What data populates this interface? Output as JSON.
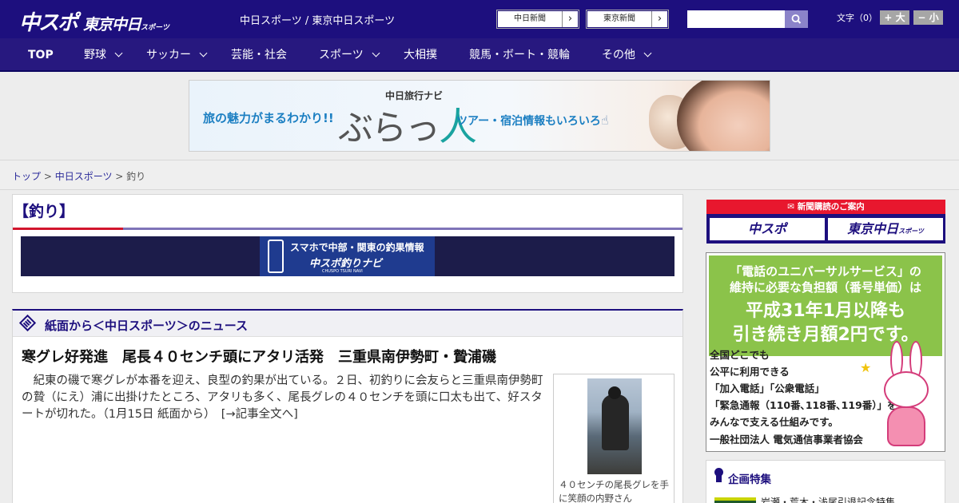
{
  "header": {
    "logo_chuspo": "中スポ",
    "logo_tokyo": "東京中日",
    "logo_tokyo_small": "スポーツ",
    "site_name": "中日スポーツ / 東京中日スポーツ",
    "paper_buttons": [
      {
        "label": "中日新聞",
        "arrow": "›"
      },
      {
        "label": "東京新聞",
        "arrow": "›"
      }
    ],
    "search_placeholder": "",
    "font_size_label": "文字（0）",
    "font_bigger": "+ 大",
    "font_smaller": "− 小"
  },
  "nav": {
    "items": [
      {
        "label": "TOP"
      },
      {
        "label": "野球"
      },
      {
        "label": "サッカー"
      },
      {
        "label": "芸能・社会"
      },
      {
        "label": "スポーツ"
      },
      {
        "label": "大相撲"
      },
      {
        "label": "競馬・ボート・競輪"
      },
      {
        "label": "その他"
      }
    ]
  },
  "ad": {
    "text_left": "旅の魅力がまるわかり!!",
    "brand_sub": "中日旅行ナビ",
    "brand_main": "ぶらっ",
    "brand_hito": "人",
    "text_right": "ツアー・宿泊情報もいろいろ",
    "hand": "☝"
  },
  "breadcrumb": {
    "items": [
      "トップ",
      "中日スポーツ",
      "釣り"
    ],
    "separator": " > "
  },
  "category": {
    "title": "【釣り】"
  },
  "navi_banner": {
    "line1": "スマホで中部・関東の釣果情報",
    "line2": "中スポ釣りナビ",
    "line3": "CHUSPO TSURI NAVI"
  },
  "news": {
    "section_label": "紙面から＜中日スポーツ＞のニュース",
    "article": {
      "title": "寒グレ好発進　尾長４０センチ頭にアタリ活発　三重県南伊勢町・贄浦磯",
      "lead": "紀東の磯で寒グレが本番を迎え、良型の釣果が出ている。２日、初釣りに会友らと三重県南伊勢町の贄（にえ）浦に出掛けたところ、アタリも多く、尾長グレの４０センチを頭に口太も出て、好スタートが切れた。（1月15日 紙面から）",
      "more_link": "[→記事全文へ]",
      "photo_caption": "４０センチの尾長グレを手に笑顔の内野さん"
    }
  },
  "sidebar": {
    "subscribe_label": "新聞購読のご案内",
    "subscribe_buttons": [
      {
        "label": "中スポ",
        "small": ""
      },
      {
        "label": "東京中日",
        "small": "スポーツ"
      }
    ],
    "universal_ad": {
      "headline1": "「電話のユニバーサルサービス」の",
      "headline2": "維持に必要な負担額（番号単価）は",
      "headline3": "平成31年1月以降も",
      "headline4": "引き続き月額2円です。",
      "body": [
        "全国どこでも",
        "公平に利用できる",
        "「加入電話」「公衆電話」",
        "「緊急通報（110番､118番､119番）」を",
        "みんなで支える仕組みです。"
      ],
      "footer": "一般社団法人 電気通信事業者協会",
      "star": "★"
    },
    "feature": {
      "label": "企画特集",
      "item": "岩瀬・荒木・浅尾引退記念特集"
    }
  },
  "colors": {
    "brand_navy": "#1d0f7e",
    "accent_red": "#e8172e",
    "universal_green": "#8bc34a"
  }
}
